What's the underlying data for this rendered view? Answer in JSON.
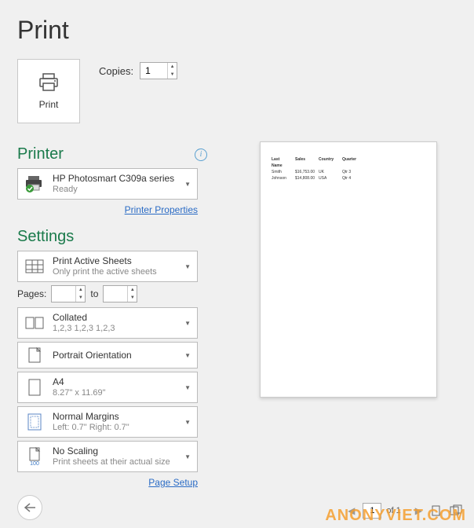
{
  "page_title": "Print",
  "print_button_label": "Print",
  "copies": {
    "label": "Copies:",
    "value": "1"
  },
  "printer": {
    "section": "Printer",
    "name": "HP Photosmart C309a series",
    "status": "Ready",
    "properties_link": "Printer Properties"
  },
  "settings": {
    "section": "Settings",
    "scope": {
      "title": "Print Active Sheets",
      "sub": "Only print the active sheets"
    },
    "pages": {
      "label": "Pages:",
      "to": "to",
      "from": "",
      "to_val": ""
    },
    "collation": {
      "title": "Collated",
      "sub": "1,2,3    1,2,3    1,2,3"
    },
    "orientation": {
      "title": "Portrait Orientation"
    },
    "paper": {
      "title": "A4",
      "sub": "8.27\" x 11.69\""
    },
    "margins": {
      "title": "Normal Margins",
      "sub": "Left:  0.7\"    Right:  0.7\""
    },
    "scaling": {
      "title": "No Scaling",
      "sub": "Print sheets at their actual size",
      "badge": "100"
    },
    "page_setup_link": "Page Setup"
  },
  "preview": {
    "headers": [
      "Last Name",
      "Sales",
      "Country",
      "Quarter"
    ],
    "rows": [
      [
        "Smith",
        "$16,753.00",
        "UK",
        "Qtr 3"
      ],
      [
        "Johnson",
        "$14,808.00",
        "USA",
        "Qtr 4"
      ]
    ]
  },
  "nav": {
    "current": "1",
    "of_label": "of 1"
  },
  "watermark": "ANONYVIET.COM"
}
